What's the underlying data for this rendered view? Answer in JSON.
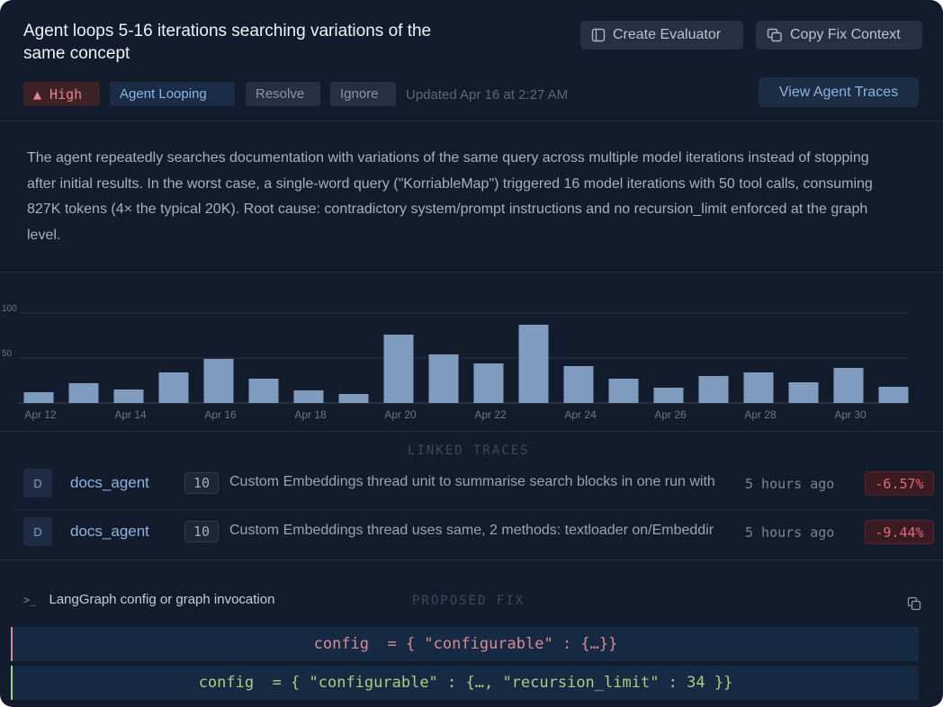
{
  "header": {
    "title": "Agent loops 5-16 iterations searching variations of the same concept",
    "create_evaluator_label": "Create Evaluator",
    "copy_fix_context_label": "Copy Fix Context"
  },
  "badges": {
    "severity_label": "▲ High",
    "category_label": "Agent Looping",
    "resolve_label": "Resolve",
    "ignore_label": "Ignore",
    "updated_text": "Updated Apr 16 at 2:27 AM",
    "view_traces_label": "View Agent Traces"
  },
  "description": "The agent repeatedly searches documentation with variations of the same query across multiple model iterations instead of stopping after initial results. In the worst case, a single-word query (\"KorriableMap\") triggered 16 model iterations with 50 tool calls, consuming 827K tokens (4× the typical 20K). Root cause: contradictory system/prompt instructions and no recursion_limit enforced at the graph level.",
  "chart_data": {
    "type": "bar",
    "categories": [
      "Apr 12",
      "Apr 13",
      "Apr 14",
      "Apr 15",
      "Apr 16",
      "Apr 17",
      "Apr 18",
      "Apr 19",
      "Apr 20",
      "Apr 21",
      "Apr 22",
      "Apr 23",
      "Apr 24",
      "Apr 25",
      "Apr 26",
      "Apr 27",
      "Apr 28",
      "Apr 29",
      "Apr 30"
    ],
    "values": [
      12,
      22,
      15,
      34,
      49,
      27,
      14,
      10,
      76,
      54,
      44,
      87,
      41,
      27,
      17,
      30,
      34,
      23,
      39,
      18
    ],
    "tick_labels": [
      "Apr 12",
      "Apr 14",
      "Apr 16",
      "Apr 18",
      "Apr 20",
      "Apr 22",
      "Apr 24",
      "Apr 26",
      "Apr 28",
      "Apr 30"
    ],
    "yticks": [
      "100",
      "50"
    ],
    "ylim": [
      0,
      100
    ],
    "grid": true,
    "bar_color": "#7f9bbd",
    "title": "",
    "xlabel": "",
    "ylabel": ""
  },
  "linked_traces": {
    "label": "LINKED TRACES",
    "rows": [
      {
        "avatar": "D",
        "agent": "docs_agent",
        "count": "10",
        "description": "Custom Embeddings thread unit to summarise search blocks in one run with",
        "time": "5 hours ago",
        "delta": "-6.57%"
      },
      {
        "avatar": "D",
        "agent": "docs_agent",
        "count": "10",
        "description": "Custom Embeddings thread uses same, 2 methods: textloader on/Embeddir",
        "time": "5 hours ago",
        "delta": "-9.44%"
      }
    ]
  },
  "proposed_fix": {
    "label": "PROPOSED FIX",
    "context_label": "LangGraph config or graph invocation",
    "removed_line": "config  = { \"configurable\" : {…}}",
    "added_line": "config  = { \"configurable\" : {…, \"recursion_limit\" : 34 }}"
  },
  "colors": {
    "panel_bg": "#121c2c",
    "accent_blue": "#8fb4df",
    "removed": "#d98a94",
    "added": "#a9cf7f"
  }
}
